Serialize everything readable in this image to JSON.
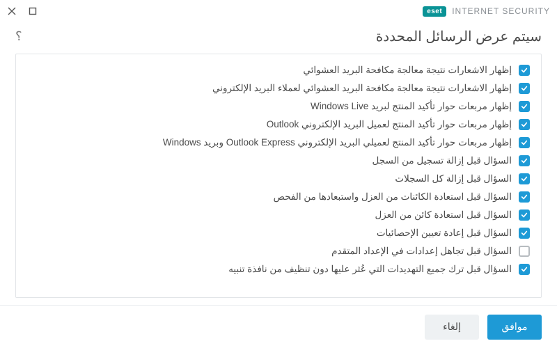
{
  "brand": {
    "badge": "eset",
    "product": "INTERNET SECURITY"
  },
  "header": {
    "title": "سيتم عرض الرسائل المحددة"
  },
  "options": [
    {
      "label": "إظهار الاشعارات نتيجة معالجة مكافحة البريد العشوائي",
      "checked": true
    },
    {
      "label": "إظهار الاشعارات نتيجة معالجة مكافحة البريد العشوائي لعملاء البريد الإلكتروني",
      "checked": true
    },
    {
      "label": "إظهار مربعات حوار تأكيد المنتج لبريد Windows Live",
      "checked": true
    },
    {
      "label": "إظهار مربعات حوار تأكيد المنتج لعميل البريد الإلكتروني Outlook",
      "checked": true
    },
    {
      "label": "إظهار مربعات حوار تأكيد المنتج لعميلي البريد الإلكتروني Outlook Express وبريد Windows",
      "checked": true
    },
    {
      "label": "السؤال قبل إزالة تسجيل من السجل",
      "checked": true
    },
    {
      "label": "السؤال قبل إزالة كل السجلات",
      "checked": true
    },
    {
      "label": "السؤال قبل استعادة الكائنات من العزل واستبعادها من الفحص",
      "checked": true
    },
    {
      "label": "السؤال قبل استعادة كائن من العزل",
      "checked": true
    },
    {
      "label": "السؤال قبل إعادة تعيين الإحصائيات",
      "checked": true
    },
    {
      "label": "السؤال قبل تجاهل إعدادات في الإعداد المتقدم",
      "checked": false
    },
    {
      "label": "السؤال قبل ترك جميع التهديدات التي عُثر عليها دون تنظيف من نافذة تنبيه",
      "checked": true
    }
  ],
  "footer": {
    "ok": "موافق",
    "cancel": "إلغاء"
  }
}
